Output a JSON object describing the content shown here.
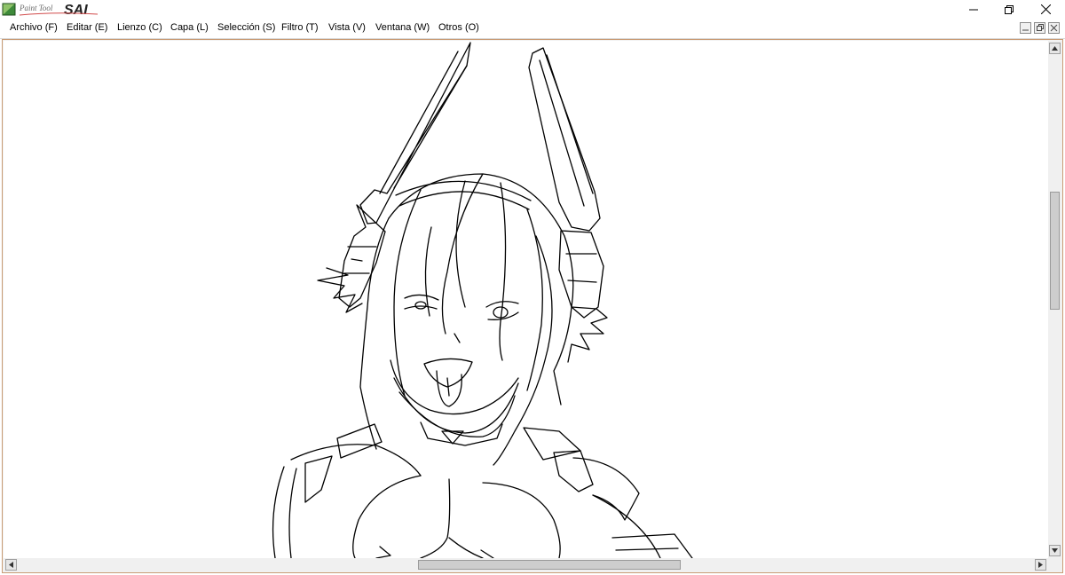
{
  "app": {
    "logo_small": "Paint Tool",
    "logo_big": "SAI"
  },
  "window_controls": [
    "minimize-icon",
    "restore-icon",
    "close-icon"
  ],
  "menu": [
    {
      "label": "Archivo (F)"
    },
    {
      "label": "Editar (E)"
    },
    {
      "label": "Lienzo (C)"
    },
    {
      "label": "Capa (L)"
    },
    {
      "label": "Selección (S)"
    },
    {
      "label": "Filtro (T)"
    },
    {
      "label": "Vista (V)"
    },
    {
      "label": "Ventana (W)"
    },
    {
      "label": "Otros (O)"
    }
  ],
  "canvas": {
    "content": "line-art drawing"
  },
  "colors": {
    "frame_border": "#c89b74",
    "scrollbar_track": "#f0f0f0",
    "scrollbar_thumb": "#cdcdcd"
  }
}
